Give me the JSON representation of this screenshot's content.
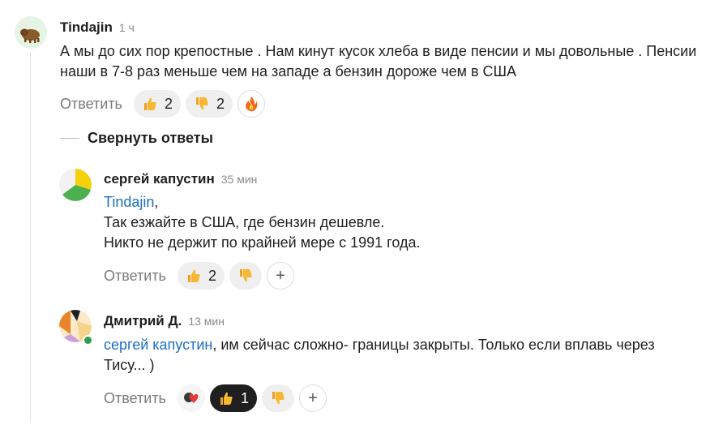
{
  "collapse_label": "Свернуть ответы",
  "comments": [
    {
      "author": "Tindajin",
      "time": "1 ч",
      "text": "А мы до сих пор крепостные . Нам кинут кусок хлеба в виде пенсии и мы довольные . Пенсии наши в 7-8 раз меньше чем на западе а бензин дороже чем в США",
      "reply_label": "Ответить",
      "likes": "2",
      "dislikes": "2",
      "avatar_icon": "yak-icon",
      "extra_reaction_icon": "fire-icon"
    },
    {
      "author": "сергей капустин",
      "time": "35 мин",
      "mention": "Tindajin",
      "mention_suffix": ",",
      "line2": "Так езжайте в США, где бензин дешевле.",
      "line3": "Никто не держит по крайней мере с 1991 года.",
      "reply_label": "Ответить",
      "likes": "2",
      "avatar_icon": "tricolor-avatar-icon"
    },
    {
      "author": "Дмитрий Д.",
      "time": "13 мин",
      "mention": "сергей капустин",
      "text": ", им сейчас сложно- границы закрыты. Только если вплавь через Тису... )",
      "reply_label": "Ответить",
      "likes": "1",
      "online_status": "online",
      "avatar_icon": "abstract-avatar-icon"
    }
  ],
  "colors": {
    "mention": "#1c6ec7",
    "online": "#2e9d4c",
    "active_reaction": "#1f1f1f"
  }
}
